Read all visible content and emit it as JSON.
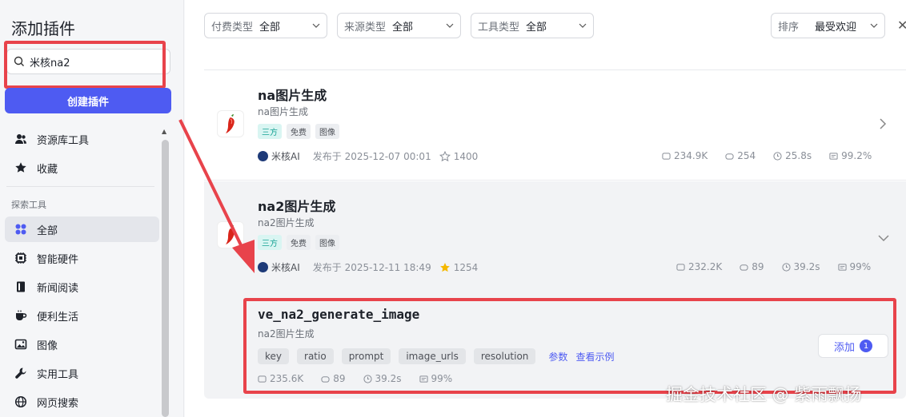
{
  "sidebar": {
    "title": "添加插件",
    "search_value": "米核na2",
    "create_button": "创建插件",
    "top_items": [
      {
        "label": "资源库工具",
        "icon": "users-icon"
      },
      {
        "label": "收藏",
        "icon": "star-icon"
      }
    ],
    "section_label": "探索工具",
    "categories": [
      {
        "label": "全部",
        "icon": "grid-icon",
        "active": true
      },
      {
        "label": "智能硬件",
        "icon": "chip-icon"
      },
      {
        "label": "新闻阅读",
        "icon": "book-icon"
      },
      {
        "label": "便利生活",
        "icon": "cup-icon"
      },
      {
        "label": "图像",
        "icon": "image-icon"
      },
      {
        "label": "实用工具",
        "icon": "wrench-icon"
      },
      {
        "label": "网页搜索",
        "icon": "globe-icon"
      }
    ]
  },
  "filters": {
    "pay": {
      "label": "付费类型",
      "value": "全部"
    },
    "source": {
      "label": "来源类型",
      "value": "全部"
    },
    "tool": {
      "label": "工具类型",
      "value": "全部"
    },
    "sort": {
      "label": "排序",
      "value": "最受欢迎"
    }
  },
  "plugins": [
    {
      "title": "na图片生成",
      "subtitle": "na图片生成",
      "tags": [
        "三方",
        "免费",
        "图像"
      ],
      "author": "米核AI",
      "published": "发布于 2025-12-07 00:01",
      "stars": "1400",
      "stats": {
        "calls": "234.9K",
        "bots": "254",
        "latency": "25.8s",
        "success": "99.2%"
      }
    },
    {
      "title": "na2图片生成",
      "subtitle": "na2图片生成",
      "tags": [
        "三方",
        "免费",
        "图像"
      ],
      "author": "米核AI",
      "published": "发布于 2025-12-11 18:49",
      "stars": "1254",
      "stats": {
        "calls": "232.2K",
        "bots": "89",
        "latency": "39.2s",
        "success": "99%"
      }
    }
  ],
  "tool": {
    "name": "ve_na2_generate_image",
    "desc": "na2图片生成",
    "params": [
      "key",
      "ratio",
      "prompt",
      "image_urls",
      "resolution"
    ],
    "params_link": "参数",
    "example_link": "查看示例",
    "add_label": "添加",
    "add_count": "1",
    "stats": {
      "calls": "235.6K",
      "bots": "89",
      "latency": "39.2s",
      "success": "99%"
    }
  },
  "watermark": "掘金技术社区 @ 紫雨飘扬",
  "colors": {
    "accent": "#4e5bf2",
    "highlight": "#e8434b",
    "tag_third": "#16a394"
  }
}
